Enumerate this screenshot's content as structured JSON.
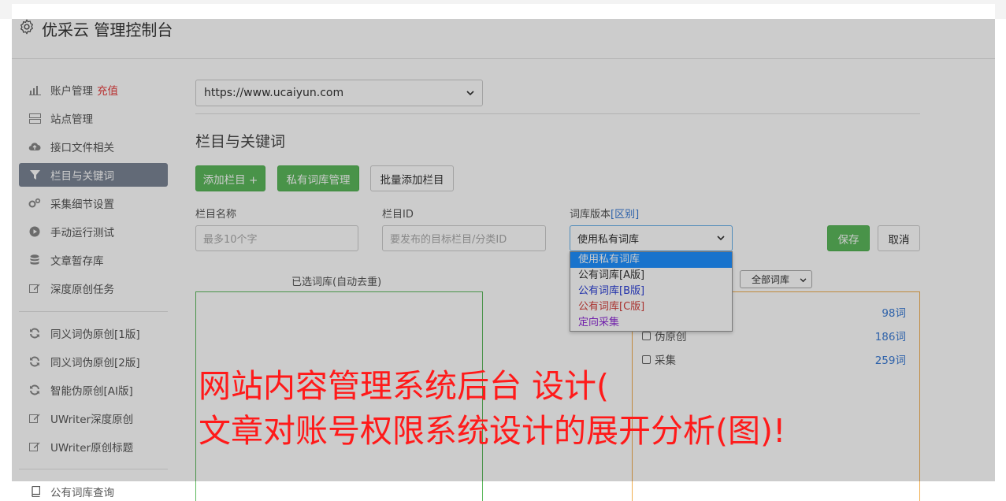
{
  "header": {
    "title": "优采云 管理控制台"
  },
  "sidebar": {
    "account": {
      "label": "账户管理",
      "recharge": "充值"
    },
    "items": [
      {
        "label": "站点管理",
        "icon": "server-icon"
      },
      {
        "label": "接口文件相关",
        "icon": "cloud-upload-icon"
      },
      {
        "label": "栏目与关键词",
        "icon": "filter-icon"
      },
      {
        "label": "采集细节设置",
        "icon": "gears-icon"
      },
      {
        "label": "手动运行测试",
        "icon": "play-circle-icon"
      },
      {
        "label": "文章暂存库",
        "icon": "database-icon"
      },
      {
        "label": "深度原创任务",
        "icon": "edit-icon"
      }
    ],
    "tools": [
      {
        "label": "同义词伪原创[1版]",
        "icon": "refresh-icon"
      },
      {
        "label": "同义词伪原创[2版]",
        "icon": "refresh-icon"
      },
      {
        "label": "智能伪原创[AI版]",
        "icon": "refresh-icon"
      },
      {
        "label": "UWriter深度原创",
        "icon": "edit-icon"
      },
      {
        "label": "UWriter原创标题",
        "icon": "edit-icon"
      }
    ],
    "bottom": {
      "label": "公有词库查询",
      "icon": "book-icon"
    }
  },
  "main": {
    "site_select_value": "https://www.ucaiyun.com",
    "section_title": "栏目与关键词",
    "buttons": {
      "add_column": "添加栏目 +",
      "private_lib": "私有词库管理",
      "batch_add": "批量添加栏目",
      "save": "保存",
      "cancel": "取消"
    },
    "form": {
      "column_name_label": "栏目名称",
      "column_name_placeholder": "最多10个字",
      "column_id_label": "栏目ID",
      "column_id_placeholder": "要发布的目标栏目/分类ID",
      "lib_version_label": "词库版本",
      "lib_version_link": "[区别]",
      "lib_version_value": "使用私有词库"
    },
    "dropdown_options": [
      {
        "label": "使用私有词库",
        "color": "#ffffff"
      },
      {
        "label": "公有词库[A版]",
        "color": "#333333"
      },
      {
        "label": "公有词库[B版]",
        "color": "#2b3fd6"
      },
      {
        "label": "公有词库[C版]",
        "color": "#d43f3a"
      },
      {
        "label": "定向采集",
        "color": "#8e2bd6"
      }
    ],
    "selected_panel_title": "已选词库(自动去重)",
    "all_lib_select": "全部词库",
    "libraries": [
      {
        "label": "",
        "count": "98词"
      },
      {
        "label": "伪原创",
        "count": "186词"
      },
      {
        "label": "采集",
        "count": "259词"
      }
    ]
  },
  "overlay_text": {
    "line1": "网站内容管理系统后台 设计(",
    "line2": "文章对账号权限系统设计的展开分析(图)!"
  }
}
